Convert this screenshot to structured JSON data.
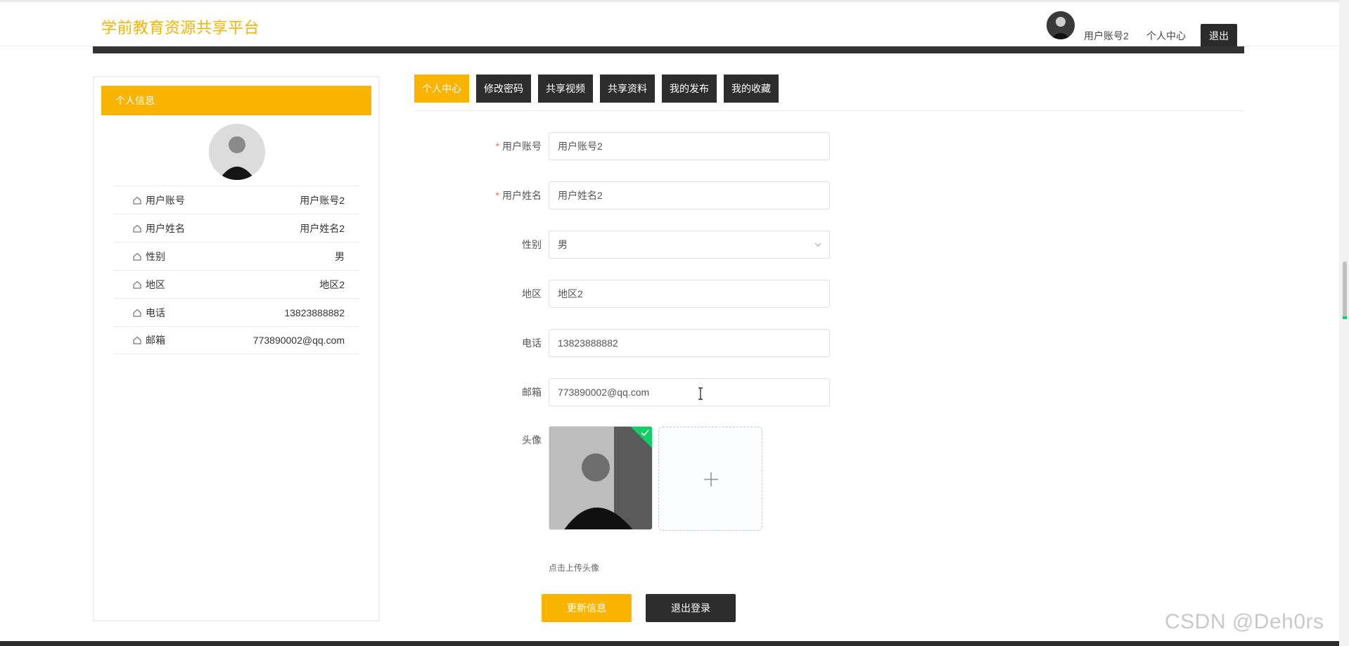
{
  "header": {
    "brand": "学前教育资源共享平台",
    "username": "用户账号2",
    "center_link": "个人中心",
    "logout": "退出"
  },
  "sidebar": {
    "title": "个人信息",
    "items": [
      {
        "label": "用户账号",
        "value": "用户账号2"
      },
      {
        "label": "用户姓名",
        "value": "用户姓名2"
      },
      {
        "label": "性别",
        "value": "男"
      },
      {
        "label": "地区",
        "value": "地区2"
      },
      {
        "label": "电话",
        "value": "13823888882"
      },
      {
        "label": "邮箱",
        "value": "773890002@qq.com"
      }
    ]
  },
  "tabs": [
    "个人中心",
    "修改密码",
    "共享视频",
    "共享资料",
    "我的发布",
    "我的收藏"
  ],
  "active_tab": "个人中心",
  "form": {
    "account": {
      "label": "用户账号",
      "required": true,
      "value": "用户账号2"
    },
    "name": {
      "label": "用户姓名",
      "required": true,
      "value": "用户姓名2"
    },
    "gender": {
      "label": "性别",
      "value": "男"
    },
    "region": {
      "label": "地区",
      "value": "地区2"
    },
    "phone": {
      "label": "电话",
      "value": "13823888882"
    },
    "email": {
      "label": "邮箱",
      "value": "773890002@qq.com"
    },
    "avatar": {
      "label": "头像",
      "tip": "点击上传头像"
    }
  },
  "buttons": {
    "update": "更新信息",
    "logout": "退出登录"
  },
  "required_mark": "*",
  "watermark": "CSDN @Deh0rs",
  "colors": {
    "accent": "#f9b400",
    "dark": "#2d2d2d",
    "success": "#13ce66",
    "required": "#f56c6c"
  },
  "icons": [
    "home-icon",
    "chevron-down-icon",
    "plus-icon",
    "check-icon",
    "text-cursor-icon"
  ]
}
